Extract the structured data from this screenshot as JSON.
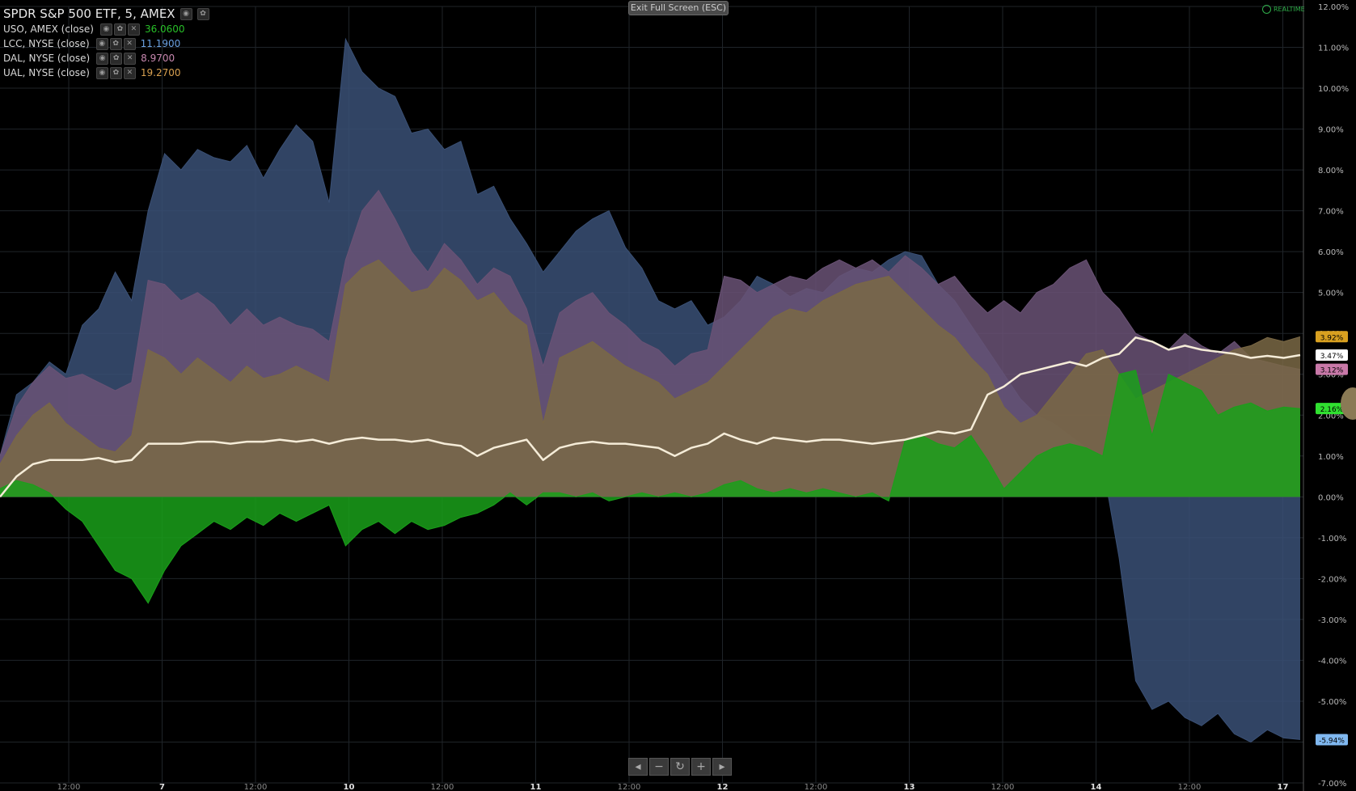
{
  "legend": {
    "title": "SPDR S&P 500 ETF, 5, AMEX",
    "rows": [
      {
        "symbol": "USO, AMEX (close)",
        "value": "36.0600",
        "color": "#28c028"
      },
      {
        "symbol": "LCC, NYSE (close)",
        "value": "11.1900",
        "color": "#6aa0e0"
      },
      {
        "symbol": "DAL, NYSE (close)",
        "value": "8.9700",
        "color": "#c888b0"
      },
      {
        "symbol": "UAL, NYSE (close)",
        "value": "19.2700",
        "color": "#d8a050"
      }
    ]
  },
  "toolbar": {
    "exit_fullscreen": "Exit Full Screen (ESC)",
    "realtime": "REALTIME"
  },
  "icons": {
    "nav": [
      "arrow-left-icon",
      "minus-icon",
      "reset-icon",
      "plus-icon",
      "arrow-right-icon"
    ]
  },
  "chart_data": {
    "type": "area",
    "ylim": [
      -7,
      12
    ],
    "y_ticks": [
      "12.00%",
      "11.00%",
      "10.00%",
      "9.00%",
      "8.00%",
      "7.00%",
      "6.00%",
      "5.00%",
      "4.00%",
      "3.00%",
      "2.00%",
      "1.00%",
      "0.00%",
      "-1.00%",
      "-2.00%",
      "-3.00%",
      "-4.00%",
      "-5.00%",
      "-6.00%",
      "-7.00%"
    ],
    "x_ticks": [
      "12:00",
      "7",
      "12:00",
      "10",
      "12:00",
      "11",
      "12:00",
      "12",
      "12:00",
      "13",
      "12:00",
      "14",
      "12:00",
      "17"
    ],
    "series": [
      {
        "name": "LCC, NYSE (close)",
        "color": "#3a5075",
        "values": [
          1,
          2.5,
          2.8,
          3.3,
          3.0,
          4.2,
          4.6,
          5.5,
          4.8,
          7.0,
          8.4,
          8.0,
          8.5,
          8.3,
          8.2,
          8.6,
          7.8,
          8.5,
          9.1,
          8.7,
          7.2,
          11.2,
          10.4,
          10.0,
          9.8,
          8.9,
          9.0,
          8.5,
          8.7,
          7.4,
          7.6,
          6.8,
          6.2,
          5.5,
          6.0,
          6.5,
          6.8,
          7.0,
          6.1,
          5.6,
          4.8,
          4.6,
          4.8,
          4.2,
          4.4,
          4.8,
          5.4,
          5.2,
          4.9,
          5.1,
          5.0,
          5.4,
          5.6,
          5.5,
          5.8,
          6.0,
          5.9,
          5.2,
          4.8,
          4.2,
          3.6,
          3.0,
          2.4,
          2.0,
          1.8,
          1.5,
          1.2,
          0.8,
          -1.5,
          -4.5,
          -5.2,
          -5.0,
          -5.4,
          -5.6,
          -5.3,
          -5.8,
          -6.0,
          -5.7,
          -5.9,
          -5.94
        ]
      },
      {
        "name": "DAL, NYSE (close)",
        "color": "#6a5275",
        "values": [
          1,
          2.2,
          2.8,
          3.2,
          2.9,
          3.0,
          2.8,
          2.6,
          2.8,
          5.3,
          5.2,
          4.8,
          5.0,
          4.7,
          4.2,
          4.6,
          4.2,
          4.4,
          4.2,
          4.1,
          3.8,
          5.8,
          7.0,
          7.5,
          6.8,
          6.0,
          5.5,
          6.2,
          5.8,
          5.2,
          5.6,
          5.4,
          4.6,
          3.2,
          4.5,
          4.8,
          5.0,
          4.5,
          4.2,
          3.8,
          3.6,
          3.2,
          3.5,
          3.6,
          5.4,
          5.3,
          5.0,
          5.2,
          5.4,
          5.3,
          5.6,
          5.8,
          5.6,
          5.8,
          5.5,
          5.9,
          5.6,
          5.2,
          5.4,
          4.9,
          4.5,
          4.8,
          4.5,
          5.0,
          5.2,
          5.6,
          5.8,
          5.0,
          4.6,
          4.0,
          3.8,
          3.6,
          4.0,
          3.7,
          3.5,
          3.8,
          3.4,
          3.3,
          3.2,
          3.12
        ]
      },
      {
        "name": "UAL, NYSE (close)",
        "color": "#7a6845",
        "values": [
          0.8,
          1.5,
          2.0,
          2.3,
          1.8,
          1.5,
          1.2,
          1.1,
          1.5,
          3.6,
          3.4,
          3.0,
          3.4,
          3.1,
          2.8,
          3.2,
          2.9,
          3.0,
          3.2,
          3.0,
          2.8,
          5.2,
          5.6,
          5.8,
          5.4,
          5.0,
          5.1,
          5.6,
          5.3,
          4.8,
          5.0,
          4.5,
          4.2,
          1.8,
          3.4,
          3.6,
          3.8,
          3.5,
          3.2,
          3.0,
          2.8,
          2.4,
          2.6,
          2.8,
          3.2,
          3.6,
          4.0,
          4.4,
          4.6,
          4.5,
          4.8,
          5.0,
          5.2,
          5.3,
          5.4,
          5.0,
          4.6,
          4.2,
          3.9,
          3.4,
          3.0,
          2.2,
          1.8,
          2.0,
          2.5,
          3.0,
          3.5,
          3.6,
          3.0,
          2.4,
          2.6,
          2.8,
          3.0,
          3.2,
          3.4,
          3.6,
          3.7,
          3.9,
          3.8,
          3.92
        ]
      },
      {
        "name": "USO, AMEX (close)",
        "color": "#1aa01a",
        "values": [
          0.2,
          0.4,
          0.3,
          0.1,
          -0.3,
          -0.6,
          -1.2,
          -1.8,
          -2.0,
          -2.6,
          -1.8,
          -1.2,
          -0.9,
          -0.6,
          -0.8,
          -0.5,
          -0.7,
          -0.4,
          -0.6,
          -0.4,
          -0.2,
          -1.2,
          -0.8,
          -0.6,
          -0.9,
          -0.6,
          -0.8,
          -0.7,
          -0.5,
          -0.4,
          -0.2,
          0.1,
          -0.2,
          0.1,
          0.1,
          0.0,
          0.1,
          -0.1,
          0.0,
          0.1,
          0.0,
          0.1,
          0.0,
          0.1,
          0.3,
          0.4,
          0.2,
          0.1,
          0.2,
          0.1,
          0.2,
          0.1,
          0.0,
          0.1,
          -0.1,
          1.4,
          1.5,
          1.3,
          1.2,
          1.5,
          0.9,
          0.2,
          0.6,
          1.0,
          1.2,
          1.3,
          1.2,
          1.0,
          3.0,
          3.1,
          1.5,
          3.0,
          2.8,
          2.6,
          2.0,
          2.2,
          2.3,
          2.1,
          2.2,
          2.16
        ]
      },
      {
        "name": "SPDR S&P 500 ETF",
        "color": "#f5ecd8",
        "values": [
          0.0,
          0.5,
          0.8,
          0.9,
          0.9,
          0.9,
          0.95,
          0.85,
          0.9,
          1.3,
          1.3,
          1.3,
          1.35,
          1.35,
          1.3,
          1.35,
          1.35,
          1.4,
          1.35,
          1.4,
          1.3,
          1.4,
          1.45,
          1.4,
          1.4,
          1.35,
          1.4,
          1.3,
          1.25,
          1.0,
          1.2,
          1.3,
          1.4,
          0.9,
          1.2,
          1.3,
          1.35,
          1.3,
          1.3,
          1.25,
          1.2,
          1.0,
          1.2,
          1.3,
          1.55,
          1.4,
          1.3,
          1.45,
          1.4,
          1.35,
          1.4,
          1.4,
          1.35,
          1.3,
          1.35,
          1.4,
          1.5,
          1.6,
          1.55,
          1.65,
          2.5,
          2.7,
          3.0,
          3.1,
          3.2,
          3.3,
          3.2,
          3.4,
          3.5,
          3.9,
          3.8,
          3.6,
          3.7,
          3.6,
          3.55,
          3.5,
          3.4,
          3.45,
          3.4,
          3.47
        ]
      }
    ],
    "end_labels": [
      {
        "text": "3.92%",
        "value": 3.92,
        "color": "#d8a020",
        "textColor": "#000"
      },
      {
        "text": "3.47%",
        "value": 3.47,
        "color": "#ffffff",
        "textColor": "#000"
      },
      {
        "text": "3.12%",
        "value": 3.12,
        "color": "#c878a8",
        "textColor": "#000"
      },
      {
        "text": "2.16%",
        "value": 2.16,
        "color": "#30e030",
        "textColor": "#000"
      },
      {
        "text": "-5.94%",
        "value": -5.94,
        "color": "#80b8f0",
        "textColor": "#000"
      }
    ]
  }
}
